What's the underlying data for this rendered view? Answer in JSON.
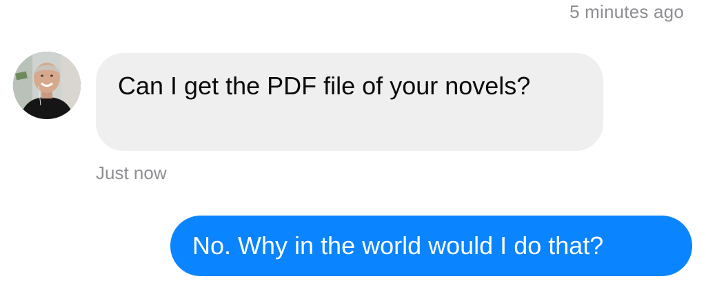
{
  "thread": {
    "top_timestamp": "5 minutes ago",
    "incoming": {
      "avatar_icon": "contact-avatar-photo",
      "text": "Can I get the PDF file of your novels?",
      "timestamp": "Just now",
      "bubble_color": "#efeff0"
    },
    "outgoing": {
      "text": "No. Why in the world would I do that?",
      "bubble_color": "#0a84ff"
    }
  }
}
